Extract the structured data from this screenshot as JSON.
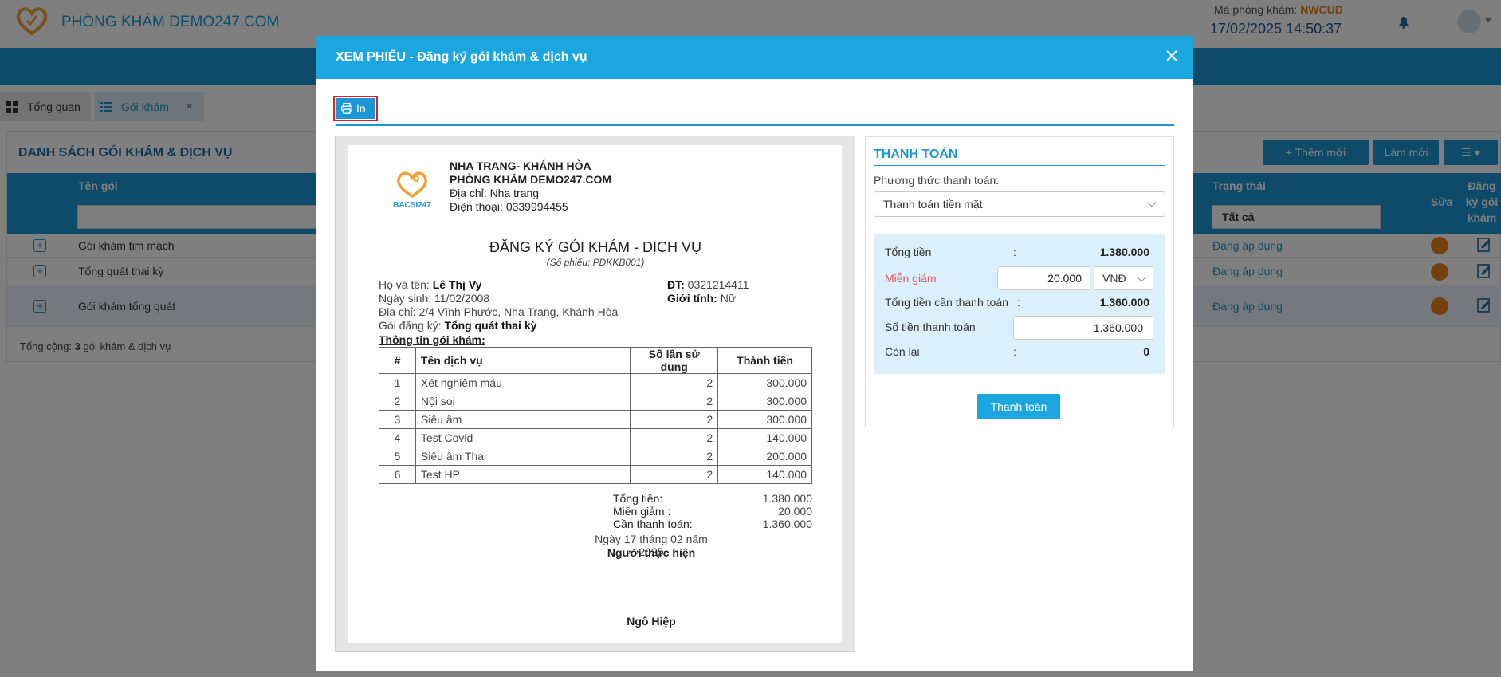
{
  "app": {
    "clinic_name": "PHÒNG KHÁM DEMO247.COM",
    "clinic_code_label": "Mã phòng khám:",
    "clinic_code": "NWCUD",
    "datetime": "17/02/2025 14:50:37"
  },
  "tabs": [
    {
      "label": "Tổng quan"
    },
    {
      "label": "Gói khám"
    }
  ],
  "list": {
    "title": "DANH SÁCH GÓI KHÁM & DỊCH VỤ",
    "add_label": "Thêm mới",
    "reload_label": "Làm mới",
    "col_name": "Tên gói",
    "col_status": "Trạng thái",
    "status_filter": "Tất cả",
    "col_edit": "Sửa",
    "col_register": "Đăng ký gói khám",
    "rows": [
      {
        "name": "Gói khám tim mạch",
        "status": "Đang áp dụng"
      },
      {
        "name": "Tổng quát thai kỳ",
        "status": "Đang áp dụng"
      },
      {
        "name": "Gói khám tổng quát",
        "status": "Đang áp dụng"
      }
    ],
    "total_prefix": "Tổng cộng:",
    "total_count": "3",
    "total_suffix": "gói khám & dịch vụ"
  },
  "modal": {
    "title": "XEM PHIẾU - Đăng ký gói khám & dịch vụ",
    "print_label": "In"
  },
  "receipt": {
    "region": "NHA TRANG- KHÁNH HÒA",
    "clinic": "PHÒNG KHÁM DEMO247.COM",
    "address_line": "Địa chỉ: Nha trang",
    "phone_line": "Điện thoại: 0339994455",
    "title": "ĐĂNG KÝ GÓI KHÁM - DỊCH VỤ",
    "receipt_no": "(Số phiếu: PDKKB001)",
    "patient_label": "Họ và tên:",
    "patient_name": "Lê Thị Vy",
    "dob_line": "Ngày sinh: 11/02/2008",
    "patient_address": "Địa chỉ: 2/4 Vĩnh Phước, Nha Trang, Khánh Hòa",
    "package_label": "Gói đăng ký:",
    "package_name": "Tổng quát thai kỳ",
    "phone_label": "ĐT:",
    "phone": "0321214411",
    "gender_label": "Giới tính:",
    "gender": "Nữ",
    "section_title": "Thông tin gói khám:",
    "table_headers": [
      "#",
      "Tên dịch vụ",
      "Số lần sử dụng",
      "Thành tiền"
    ],
    "items": [
      {
        "no": "1",
        "service": "Xét nghiệm máu",
        "times": "2",
        "amount": "300.000"
      },
      {
        "no": "2",
        "service": "Nội soi",
        "times": "2",
        "amount": "300.000"
      },
      {
        "no": "3",
        "service": "Siêu âm",
        "times": "2",
        "amount": "300.000"
      },
      {
        "no": "4",
        "service": "Test Covid",
        "times": "2",
        "amount": "140.000"
      },
      {
        "no": "5",
        "service": "Siêu âm Thai",
        "times": "2",
        "amount": "200.000"
      },
      {
        "no": "6",
        "service": "Test HP",
        "times": "2",
        "amount": "140.000"
      }
    ],
    "total_label": "Tổng tiền:",
    "total_value": "1.380.000",
    "discount_label": "Miễn giảm :",
    "discount_value": "20.000",
    "due_label": "Cần thanh toán:",
    "due_value": "1.360.000",
    "date_line": "Ngày 17 tháng 02 năm 2025",
    "signer_title": "Người thực hiện",
    "signer_name": "Ngô Hiệp"
  },
  "payment": {
    "title": "THANH TOÁN",
    "method_label": "Phương thức thanh toán:",
    "method_value": "Thanh toán tiền mặt",
    "total_label": "Tổng tiền",
    "total_value": "1.380.000",
    "discount_label": "Miễn giảm",
    "discount_value": "20.000",
    "currency": "VNĐ",
    "due_label": "Tổng tiền cần thanh toán",
    "due_value": "1.360.000",
    "paid_label": "Số tiền thanh toán",
    "paid_value": "1.360.000",
    "remaining_label": "Còn lại",
    "remaining_value": "0",
    "submit_label": "Thanh toán"
  },
  "colors": {
    "primary": "#1c96d6",
    "modal_header": "#1ca6df",
    "accent_orange": "#e8811a",
    "discount_red": "#e2575e",
    "highlight_red": "#e31e24"
  }
}
